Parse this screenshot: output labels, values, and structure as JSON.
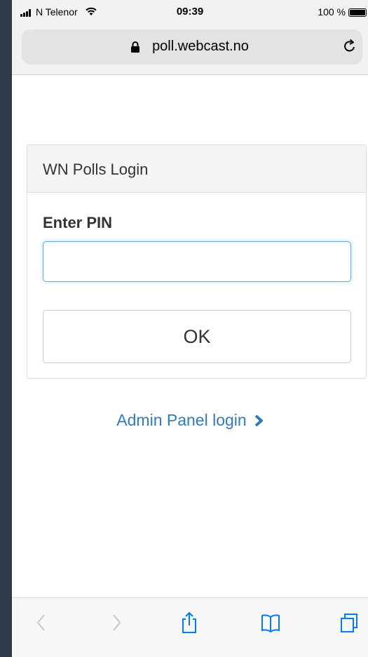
{
  "status_bar": {
    "carrier": "N Telenor",
    "time": "09:39",
    "battery_percent": "100 %"
  },
  "address_bar": {
    "url": "poll.webcast.no"
  },
  "login_panel": {
    "title": "WN Polls Login",
    "pin_label": "Enter PIN",
    "pin_value": "",
    "ok_label": "OK"
  },
  "admin_link": {
    "label": "Admin Panel login"
  },
  "toolbar": {
    "icons": [
      "back-icon",
      "forward-icon",
      "share-icon",
      "bookmarks-icon",
      "tabs-icon"
    ]
  },
  "colors": {
    "link": "#337ab7",
    "input_focus": "#66afe9",
    "side_background": "#2f3a4a"
  }
}
